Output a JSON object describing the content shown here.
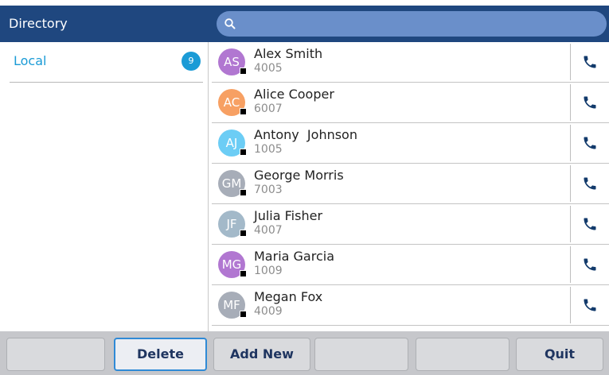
{
  "header": {
    "title": "Directory"
  },
  "search": {
    "placeholder": ""
  },
  "sidebar": {
    "items": [
      {
        "label": "Local",
        "count": "9"
      }
    ]
  },
  "contacts": [
    {
      "initials": "AS",
      "name": "Alex Smith",
      "ext": "4005",
      "color": "#b177d1"
    },
    {
      "initials": "AC",
      "name": "Alice Cooper",
      "ext": "6007",
      "color": "#f7a063"
    },
    {
      "initials": "AJ",
      "name": "Antony  Johnson",
      "ext": "1005",
      "color": "#6ccdf5"
    },
    {
      "initials": "GM",
      "name": "George Morris",
      "ext": "7003",
      "color": "#a7adb8"
    },
    {
      "initials": "JF",
      "name": "Julia Fisher",
      "ext": "4007",
      "color": "#a3b9c9"
    },
    {
      "initials": "MG",
      "name": "Maria Garcia",
      "ext": "1009",
      "color": "#b177d1"
    },
    {
      "initials": "MF",
      "name": "Megan Fox",
      "ext": "4009",
      "color": "#a7adb8"
    }
  ],
  "softkeys": [
    {
      "label": "",
      "active": false
    },
    {
      "label": "Delete",
      "active": true
    },
    {
      "label": "Add New",
      "active": false
    },
    {
      "label": "",
      "active": false
    },
    {
      "label": "",
      "active": false
    },
    {
      "label": "Quit",
      "active": false
    }
  ],
  "colors": {
    "header_bg": "#1f477f",
    "search_bg": "#6a8fca",
    "accent": "#1b9bd6",
    "softkey_bar": "#c6c7cb",
    "call_icon": "#123a6b"
  },
  "icons": {
    "search": "search-icon",
    "call": "phone-icon"
  }
}
